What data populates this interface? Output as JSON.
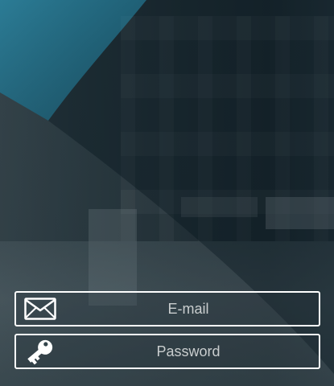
{
  "login_form": {
    "email_field": {
      "placeholder": "E-mail",
      "value": "",
      "icon": "envelope-icon"
    },
    "password_field": {
      "placeholder": "Password",
      "value": "",
      "icon": "key-icon"
    }
  },
  "colors": {
    "accent_teal": "#1f6f8b",
    "field_border": "#ffffff",
    "placeholder_text": "#c9cdce"
  }
}
